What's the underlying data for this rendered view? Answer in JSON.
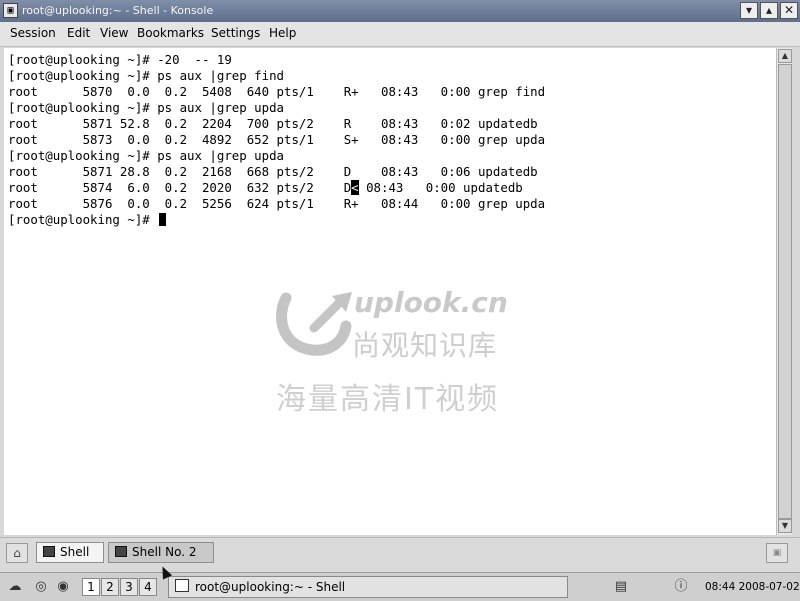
{
  "window": {
    "title": "root@uplooking:~ - Shell - Konsole",
    "controls": [
      "minimize-icon",
      "maximize-icon",
      "close-icon"
    ]
  },
  "menubar": {
    "items": [
      "Session",
      "Edit",
      "View",
      "Bookmarks",
      "Settings",
      "Help"
    ]
  },
  "terminal": {
    "lines": [
      "[root@uplooking ~]# -20  -- 19",
      "[root@uplooking ~]# ps aux |grep find",
      "root      5870  0.0  0.2  5408  640 pts/1    R+   08:43   0:00 grep find",
      "[root@uplooking ~]# ps aux |grep upda",
      "root      5871 52.8  0.2  2204  700 pts/2    R    08:43   0:02 updatedb",
      "root      5873  0.0  0.2  4892  652 pts/1    S+   08:43   0:00 grep upda",
      "[root@uplooking ~]# ps aux |grep upda",
      "root      5871 28.8  0.2  2168  668 pts/2    D    08:43   0:06 updatedb",
      "root      5874  6.0  0.2  2020  632 pts/2    D",
      "root      5876  0.0  0.2  5256  624 pts/1    R+   08:44   0:00 grep upda",
      "[root@uplooking ~]# "
    ],
    "line9_highlight": "<",
    "line9_rest": " 08:43   0:00 updatedb"
  },
  "watermark": {
    "url": "uplook.cn",
    "line1": "尚观知识库",
    "line2": "海量高清IT视频"
  },
  "tabs": {
    "items": [
      "Shell",
      "Shell No. 2"
    ],
    "active": 0
  },
  "taskbar": {
    "desktops": [
      "1",
      "2",
      "3",
      "4"
    ],
    "task_title": "root@uplooking:~ - Shell",
    "clock": "08:44 2008-07-02"
  }
}
